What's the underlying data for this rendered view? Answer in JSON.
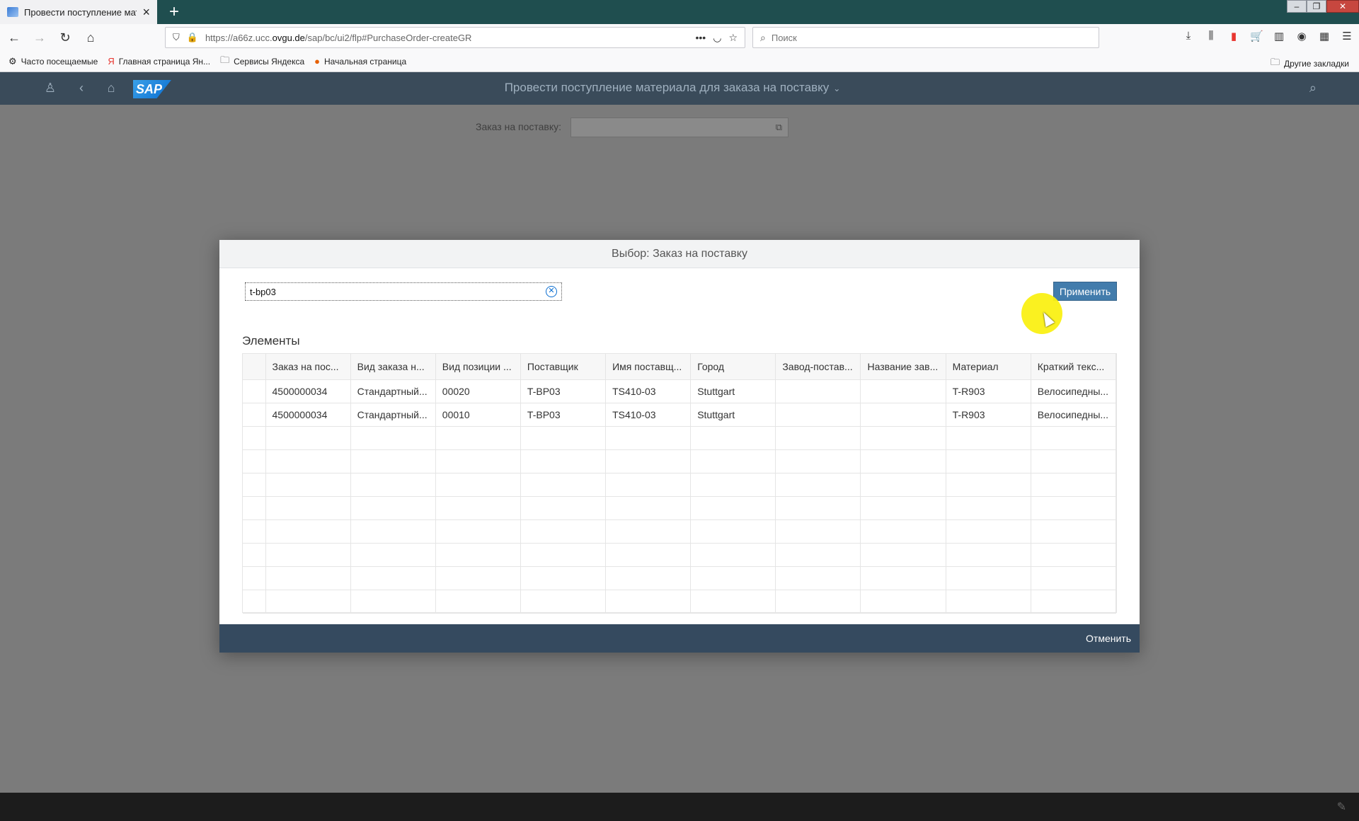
{
  "browser": {
    "tab_title": "Провести поступление матер",
    "url_host": "https://a66z.ucc.",
    "url_domain": "ovgu.de",
    "url_path": "/sap/bc/ui2/flp#PurchaseOrder-createGR",
    "search_placeholder": "Поиск",
    "bookmarks": [
      "Часто посещаемые",
      "Главная страница Ян...",
      "Сервисы Яндекса",
      "Начальная страница"
    ],
    "bookmarks_other": "Другие закладки"
  },
  "shell": {
    "app_title": "Провести поступление материала для заказа на поставку"
  },
  "page": {
    "po_label": "Заказ на поставку:"
  },
  "dialog": {
    "title": "Выбор: Заказ на поставку",
    "search_value": "t-bp03",
    "apply_label": "Применить",
    "section_title": "Элементы",
    "cancel_label": "Отменить",
    "columns": [
      "Заказ на пос...",
      "Вид заказа н...",
      "Вид позиции ...",
      "Поставщик",
      "Имя поставщ...",
      "Город",
      "Завод-постав...",
      "Название зав...",
      "Материал",
      "Краткий текс..."
    ],
    "rows": [
      [
        "4500000034",
        "Стандартный...",
        "00020",
        "T-BP03",
        "TS410-03",
        "Stuttgart",
        "",
        "",
        "T-R903",
        "Велосипедны..."
      ],
      [
        "4500000034",
        "Стандартный...",
        "00010",
        "T-BP03",
        "TS410-03",
        "Stuttgart",
        "",
        "",
        "T-R903",
        "Велосипедны..."
      ]
    ],
    "empty_rows": 8
  }
}
